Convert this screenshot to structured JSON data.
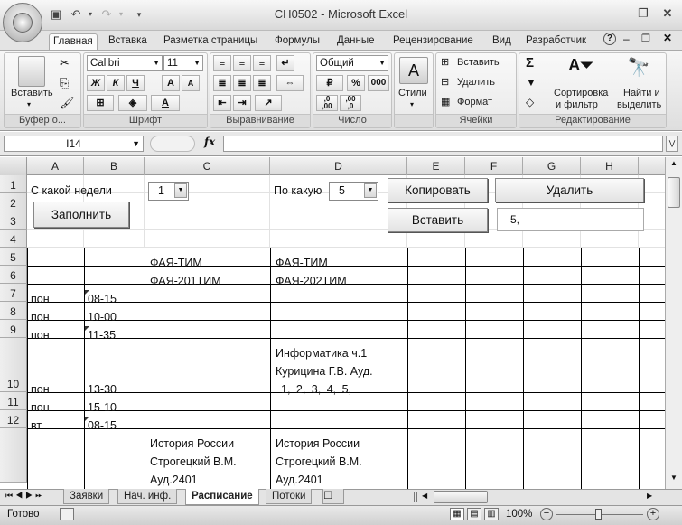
{
  "window": {
    "title": "CH0502 - Microsoft Excel"
  },
  "tabs": [
    "Главная",
    "Вставка",
    "Разметка страницы",
    "Формулы",
    "Данные",
    "Рецензирование",
    "Вид",
    "Разработчик"
  ],
  "ribbon": {
    "clipboard": {
      "paste": "Вставить",
      "group": "Буфер о..."
    },
    "font": {
      "name": "Calibri",
      "size": "11",
      "bold": "Ж",
      "italic": "К",
      "underline": "Ч",
      "grow": "A",
      "shrink": "A",
      "color": "A",
      "group": "Шрифт"
    },
    "alignment": {
      "group": "Выравнивание"
    },
    "number": {
      "format": "Общий",
      "percent": "%",
      "thousands": "000",
      "inc": ",0\n,00",
      "dec": ",00\n,0",
      "group": "Число"
    },
    "styles": {
      "label": "Стили"
    },
    "cells": {
      "insert": "Вставить",
      "delete": "Удалить",
      "format": "Формат",
      "group": "Ячейки"
    },
    "editing": {
      "sigma": "Σ",
      "sort1": "Сортировка",
      "sort2": "и фильтр",
      "find1": "Найти и",
      "find2": "выделить",
      "group": "Редактирование"
    }
  },
  "formula_bar": {
    "name_box": "I14",
    "fx": "fx",
    "value": ""
  },
  "columns": [
    "A",
    "B",
    "C",
    "D",
    "E",
    "F",
    "G",
    "H"
  ],
  "rows": [
    "1",
    "2",
    "3",
    "4",
    "5",
    "6",
    "7",
    "8",
    "9",
    "10",
    "11",
    "12"
  ],
  "controls": {
    "from_week_label": "С какой недели",
    "from_week_value": "1",
    "to_week_label": "По какую",
    "to_week_value": "5",
    "fill_button": "Заполнить",
    "copy_button": "Копировать",
    "delete_button": "Удалить",
    "insert_button": "Вставить",
    "textbox_value": "5,"
  },
  "cells": {
    "C5": "ФАЯ-ТИМ",
    "D5": "ФАЯ-ТИМ",
    "C6": "ФАЯ-201ТИМ",
    "D6": "ФАЯ-202ТИМ",
    "A7": "пон",
    "B7": "08-15",
    "A8": "пон",
    "B8": "10-00",
    "A9": "пон",
    "B9": "11-35",
    "D10a": "Информатика ч.1",
    "D10b": "Курицина Г.В. Ауд.",
    "D10c": "1, 2, 3, 4, 5,",
    "A10": "пон",
    "B10": "13-30",
    "A11": "пон",
    "B11": "15-10",
    "A12": "вт",
    "B12": "08-15",
    "C13a": "История России",
    "C13b": "Строгецкий В.М.",
    "C13c": "Ауд.2401",
    "D13a": "История России",
    "D13b": "Строгецкий В.М.",
    "D13c": "Ауд.2401"
  },
  "sheets": [
    "Заявки",
    "Нач. инф.",
    "Расписание",
    "Потоки"
  ],
  "status": {
    "ready": "Готово",
    "zoom": "100%"
  }
}
